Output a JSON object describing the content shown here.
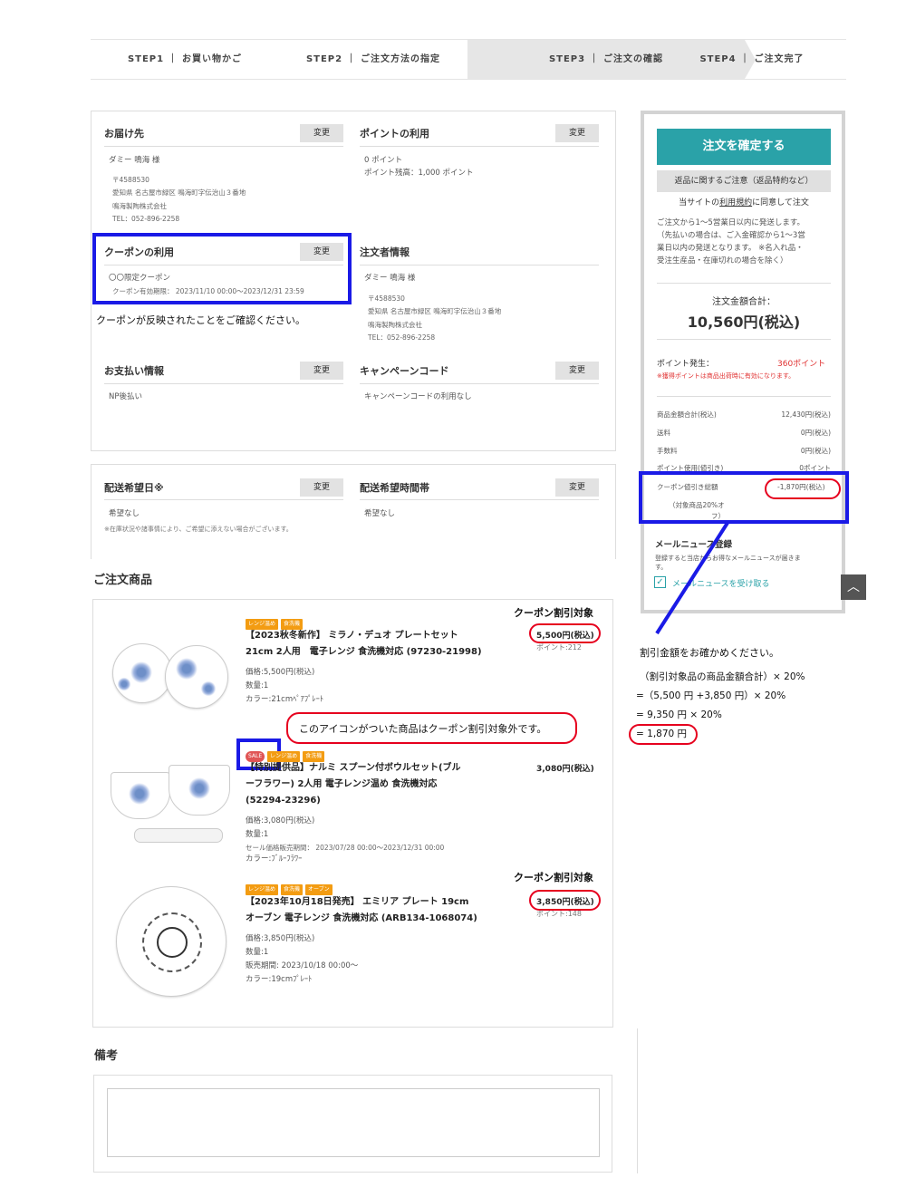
{
  "steps": [
    {
      "label": "STEP1 ｜ お買い物かご"
    },
    {
      "label": "STEP2 ｜ ご注文方法の指定"
    },
    {
      "label": "STEP3 ｜ ご注文の確認"
    },
    {
      "label": "STEP4 ｜ ご注文完了"
    }
  ],
  "change_label": "変更",
  "delivery": {
    "title": "お届け先",
    "name": "ダミー 鳴海 様",
    "postal": "〒4588530",
    "address": "愛知県 名古屋市緑区 鳴海町字伝治山３番地",
    "company": "鳴海製陶株式会社",
    "tel": "TEL：052-896-2258"
  },
  "points": {
    "title": "ポイントの利用",
    "used": "0 ポイント",
    "balance": "ポイント残高：1,000 ポイント"
  },
  "coupon": {
    "title": "クーポンの利用",
    "name": "〇〇限定クーポン",
    "validity": "クーポン有効期限： 2023/11/10 00:00〜2023/12/31 23:59",
    "note": "クーポンが反映されたことをご確認ください。"
  },
  "orderer": {
    "title": "注文者情報",
    "name": "ダミー 鳴海 様",
    "postal": "〒4588530",
    "address": "愛知県 名古屋市緑区 鳴海町字伝治山３番地",
    "company": "鳴海製陶株式会社",
    "tel": "TEL：052-896-2258"
  },
  "payment": {
    "title": "お支払い情報",
    "value": "NP後払い"
  },
  "campaign": {
    "title": "キャンペーンコード",
    "value": "キャンペーンコードの利用なし"
  },
  "delivery_date": {
    "title": "配送希望日※",
    "value": "希望なし",
    "note": "※在庫状況や諸事情により、ご希望に添えない場合がございます。"
  },
  "delivery_time": {
    "title": "配送希望時間帯",
    "value": "希望なし"
  },
  "order_items_title": "ご注文商品",
  "coupon_target_label": "クーポン割引対象",
  "products": [
    {
      "tags": [
        "レンジ温め",
        "食洗機"
      ],
      "name1": "【2023秋冬新作】 ミラノ・デュオ プレートセット",
      "name2": "21cm 2人用　電子レンジ 食洗機対応 (97230-21998)",
      "price_right": "5,500円(税込)",
      "points": "ポイント:212",
      "price": "価格:5,500円(税込)",
      "qty": "数量:1",
      "color": "カラー:21cmﾍﾟｱﾌﾟﾚｰﾄ"
    },
    {
      "sale": "SALE",
      "tags": [
        "レンジ温め",
        "食洗機"
      ],
      "name1": "【特別提供品】ナルミ スプーン付ボウルセット(ブル",
      "name2": "ーフラワー) 2人用 電子レンジ温め 食洗機対応",
      "name3": "(52294-23296)",
      "price_right": "3,080円(税込)",
      "price": "価格:3,080円(税込)",
      "qty": "数量:1",
      "sale_period": "セール価格販売期間： 2023/07/28 00:00〜2023/12/31 00:00",
      "color": "カラー:ﾌﾞﾙｰﾌﾗﾜｰ"
    },
    {
      "tags": [
        "レンジ温め",
        "食洗機",
        "オーブン"
      ],
      "name1": "【2023年10月18日発売】 エミリア プレート 19cm",
      "name2": "オーブン 電子レンジ 食洗機対応 (ARB134-1068074)",
      "price_right": "3,850円(税込)",
      "points": "ポイント:148",
      "price": "価格:3,850円(税込)",
      "qty": "数量:1",
      "sale_period": "販売期間: 2023/10/18 00:00〜",
      "color": "カラー:19cmﾌﾟﾚｰﾄ"
    }
  ],
  "sale_note": "このアイコンがついた商品はクーポン割引対象外です。",
  "remarks_title": "備考",
  "sidebar": {
    "confirm": "注文を確定する",
    "returns": "返品に関するご注意（返品特約など）",
    "agree_pre": "当サイトの",
    "agree_link": "利用規約",
    "agree_post": "に同意して注文",
    "ship_note1": "ご注文から1〜5営業日以内に発送します。",
    "ship_note2": "（先払いの場合は、ご入金確認から1〜3営",
    "ship_note3": "業日以内の発送となります。 ※名入れ品・",
    "ship_note4": "受注生産品・在庫切れの場合を除く）",
    "total_label": "注文金額合計：",
    "total_value": "10,560円(税込)",
    "total_suffix": "(税込)",
    "total_amount": "10,560円",
    "points_label": "ポイント発生：",
    "points_value": "360ポイント",
    "points_note": "※獲得ポイントは商品出荷時に有効になります。",
    "rows": [
      {
        "label": "商品金額合計(税込)",
        "value": "12,430円(税込)"
      },
      {
        "label": "送料",
        "value": "0円(税込)"
      },
      {
        "label": "手数料",
        "value": "0円(税込)"
      },
      {
        "label": "ポイント使用(値引き)",
        "value": "0ポイント"
      }
    ],
    "coupon_label": "クーポン値引き総額",
    "coupon_sub1": "（対象商品20%オ",
    "coupon_sub2": "フ）",
    "coupon_value": "-1,870円(税込)",
    "mail_title": "メールニュース登録",
    "mail_desc1": "登録すると当店からお得なメールニュースが届きま",
    "mail_desc2": "す。",
    "mail_check": "メールニュースを受け取る"
  },
  "calc": {
    "title": "割引金額をお確かめください。",
    "line1": "（割引対象品の商品金額合計）× 20%",
    "line2": "=（5,500 円 +3,850 円）× 20%",
    "line3": "= 9,350 円 × 20%",
    "line4": "= 1,870 円"
  },
  "colors": {
    "accent": "#2aa2a8",
    "highlight_blue": "#1a1ae6",
    "highlight_red": "#e6001e",
    "tag_orange": "#f39c12",
    "sale_red": "#e05555"
  }
}
